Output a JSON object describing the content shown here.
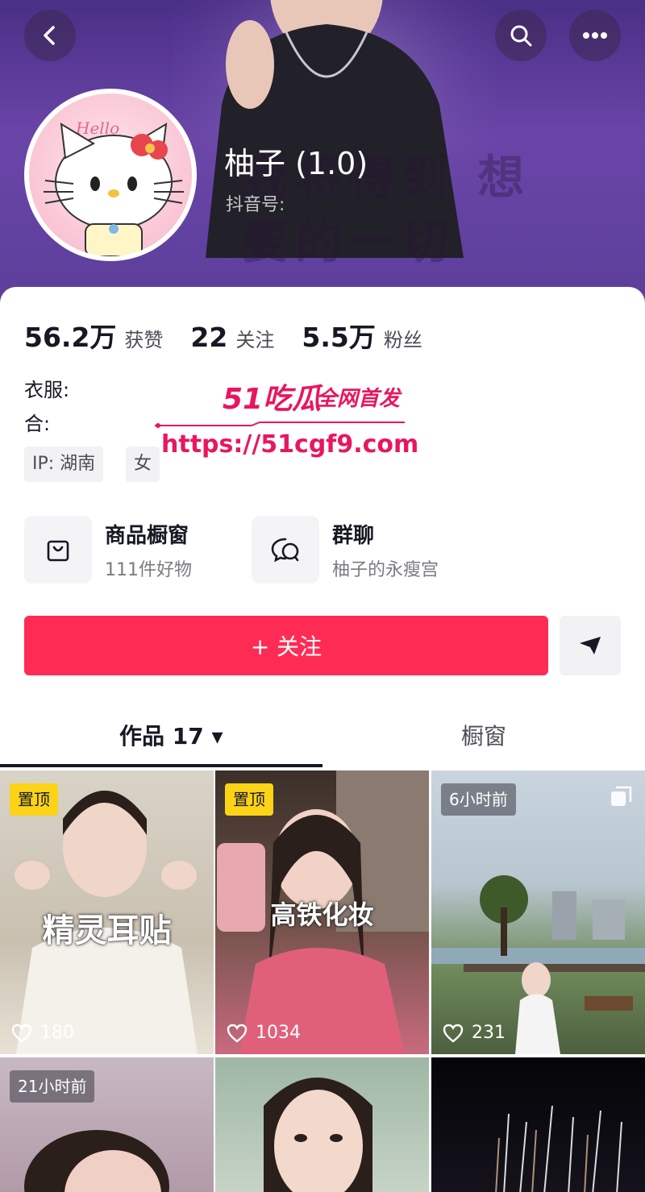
{
  "header": {
    "nickname": "柚子 (1.0)",
    "douyin_id_label": "抖音号:",
    "background_text": "我将得到 想要的一切",
    "avatar_text": "Hello"
  },
  "stats": [
    {
      "value": "56.2万",
      "label": "获赞"
    },
    {
      "value": "22",
      "label": "关注"
    },
    {
      "value": "5.5万",
      "label": "粉丝"
    }
  ],
  "bio": {
    "line1": "衣服:",
    "line2": "合:"
  },
  "tags": [
    "IP: 湖南",
    "女"
  ],
  "watermark": {
    "logo": "51吃瓜",
    "slogan": "全网首发",
    "url": "https://51cgf9.com"
  },
  "features": [
    {
      "title": "商品橱窗",
      "subtitle": "111件好物",
      "icon": "shopping-bag-icon"
    },
    {
      "title": "群聊",
      "subtitle": "柚子的永瘦宫",
      "icon": "group-chat-icon"
    }
  ],
  "follow_button": "+ 关注",
  "tabs": [
    {
      "label": "作品 17 ▾"
    },
    {
      "label": "橱窗"
    }
  ],
  "videos": [
    {
      "badge": "置顶",
      "caption": "精灵耳贴",
      "likes": "180"
    },
    {
      "badge": "置顶",
      "caption": "高铁化妆",
      "likes": "1034"
    },
    {
      "badge": "6小时前",
      "caption": "",
      "likes": "231"
    },
    {
      "badge": "21小时前",
      "caption": "",
      "likes": ""
    },
    {
      "badge": "",
      "caption": "",
      "likes": ""
    },
    {
      "badge": "",
      "caption": "",
      "likes": ""
    }
  ],
  "colors": {
    "accent": "#fe2c55",
    "pin_badge": "#fcd316",
    "watermark": "#e8175d",
    "banner": "#5c3f9a"
  }
}
